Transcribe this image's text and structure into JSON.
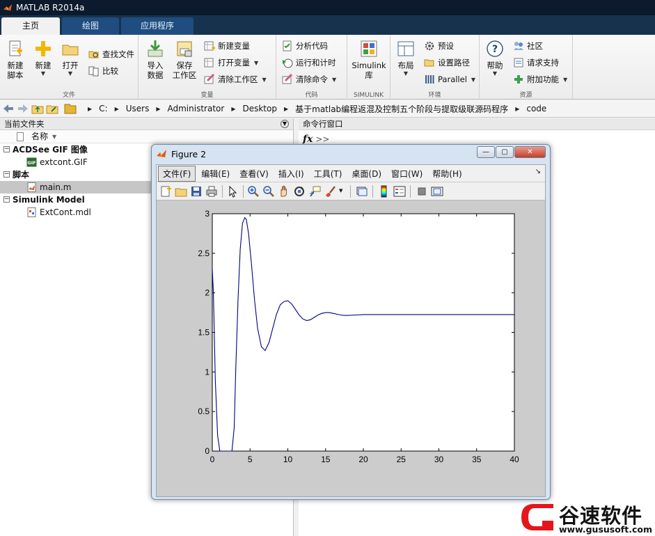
{
  "window": {
    "title": "MATLAB R2014a"
  },
  "tabs": [
    {
      "label": "主页",
      "active": true
    },
    {
      "label": "绘图",
      "active": false
    },
    {
      "label": "应用程序",
      "active": false
    }
  ],
  "ribbon": {
    "file": {
      "group_label": "文件",
      "new_script": [
        "新建",
        "脚本"
      ],
      "new": "新建",
      "open": "打开",
      "find_files": "查找文件",
      "compare": "比较"
    },
    "variable": {
      "group_label": "变量",
      "import_data": [
        "导入",
        "数据"
      ],
      "save_workspace": [
        "保存",
        "工作区"
      ],
      "new_variable": "新建变量",
      "open_variable": "打开变量",
      "clear_workspace": "清除工作区"
    },
    "code": {
      "group_label": "代码",
      "analyze_code": "分析代码",
      "run_and_time": "运行和计时",
      "clear_commands": "清除命令"
    },
    "simulink": {
      "group_label": "SIMULINK",
      "library": [
        "Simulink",
        "库"
      ]
    },
    "environment": {
      "group_label": "环境",
      "layout": "布局",
      "preferences": "预设",
      "set_path": "设置路径",
      "parallel": "Parallel"
    },
    "resources": {
      "group_label": "资源",
      "help": "帮助",
      "community": "社区",
      "request_support": "请求支持",
      "add_ons": "附加功能"
    }
  },
  "address": {
    "crumbs": [
      "C:",
      "Users",
      "Administrator",
      "Desktop",
      "基于matlab编程返混及控制五个阶段与提取级联源码程序",
      "code"
    ]
  },
  "current_folder": {
    "title": "当前文件夹",
    "column_name": "名称",
    "sections": [
      {
        "label": "ACDSee GIF 图像",
        "files": [
          "extcont.GIF"
        ]
      },
      {
        "label": "脚本",
        "files": [
          "main.m"
        ]
      },
      {
        "label": "Simulink Model",
        "files": [
          "ExtCont.mdl"
        ]
      }
    ],
    "selected_file": "main.m"
  },
  "command_window": {
    "title": "命令行窗口",
    "fx": "fx",
    "prompt": ">>"
  },
  "figure": {
    "title": "Figure 2",
    "menus": [
      "文件(F)",
      "编辑(E)",
      "查看(V)",
      "插入(I)",
      "工具(T)",
      "桌面(D)",
      "窗口(W)",
      "帮助(H)"
    ],
    "active_menu": "文件(F)",
    "toolbar_icons": [
      "new-figure-icon",
      "open-file-icon",
      "save-icon",
      "print-icon",
      "pointer-icon",
      "zoom-in-icon",
      "zoom-out-icon",
      "pan-icon",
      "rotate-icon",
      "data-cursor-icon",
      "brush-icon",
      "link-plot-icon",
      "colorbar-icon",
      "legend-icon",
      "hide-plot-tools-icon",
      "show-plot-tools-icon"
    ]
  },
  "chart_data": {
    "type": "line",
    "title": "",
    "xlabel": "",
    "ylabel": "",
    "xlim": [
      0,
      40
    ],
    "ylim": [
      0,
      3
    ],
    "xticks": [
      0,
      5,
      10,
      15,
      20,
      25,
      30,
      35,
      40
    ],
    "yticks": [
      0,
      0.5,
      1,
      1.5,
      2,
      2.5,
      3
    ],
    "grid": false,
    "color": "#00007f",
    "series": [
      {
        "x": [
          0,
          0.15,
          0.4,
          0.7,
          1.0,
          1.4,
          2.0,
          2.6,
          2.9,
          3.1,
          3.4,
          3.7,
          4.0,
          4.3,
          4.5,
          4.8,
          5.2,
          5.6,
          6.0,
          6.5,
          7.0,
          7.5,
          8.0,
          8.5,
          9.0,
          9.5,
          10.0,
          10.5,
          11.0,
          11.5,
          12.0,
          12.5,
          13.0,
          13.5,
          14.0,
          14.5,
          15.0,
          15.5,
          16.0,
          16.5,
          17.0,
          17.5,
          18.0,
          19.0,
          20.0,
          22.0,
          25.0,
          30.0,
          35.0,
          40.0
        ],
        "y": [
          2.3,
          2.0,
          0.9,
          0.2,
          0.0,
          0.0,
          0.0,
          0.0,
          0.3,
          1.0,
          1.9,
          2.55,
          2.88,
          2.95,
          2.93,
          2.75,
          2.35,
          1.9,
          1.55,
          1.32,
          1.27,
          1.37,
          1.55,
          1.73,
          1.85,
          1.89,
          1.9,
          1.86,
          1.79,
          1.72,
          1.67,
          1.65,
          1.66,
          1.69,
          1.72,
          1.74,
          1.75,
          1.75,
          1.74,
          1.73,
          1.72,
          1.715,
          1.715,
          1.72,
          1.725,
          1.725,
          1.725,
          1.725,
          1.725,
          1.725
        ]
      }
    ]
  },
  "watermark": {
    "text": "谷速软件",
    "url": "www.gususoft.com"
  }
}
